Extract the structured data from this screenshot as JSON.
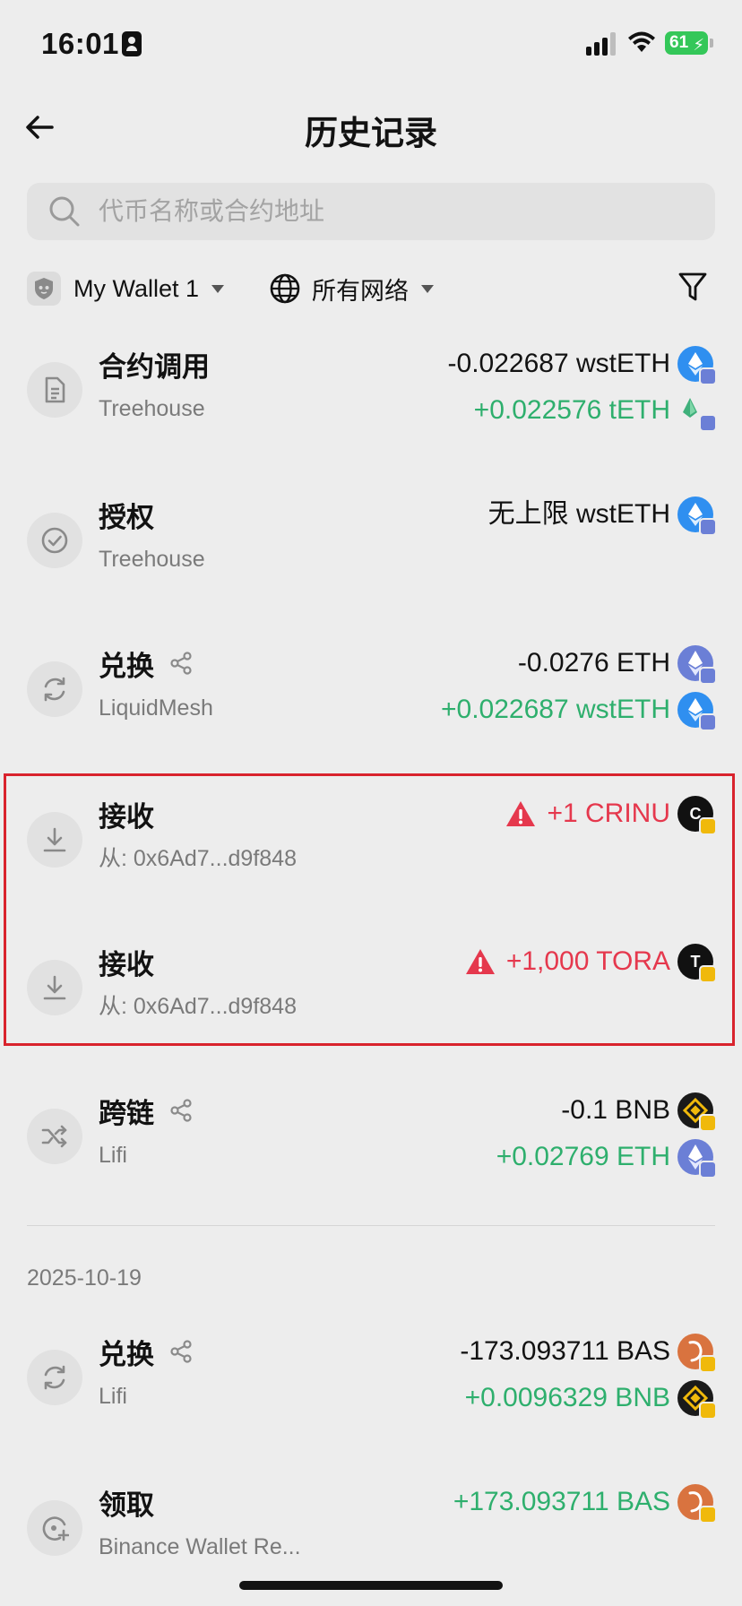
{
  "status_bar": {
    "time": "16:01",
    "battery": "61"
  },
  "header": {
    "title": "历史记录"
  },
  "search": {
    "placeholder": "代币名称或合约地址"
  },
  "filters": {
    "wallet": "My Wallet 1",
    "network": "所有网络"
  },
  "colors": {
    "positive": "#2eaf6d",
    "warning": "#e5384d",
    "highlight_border": "#d9232d"
  },
  "transactions": [
    {
      "type": "合约调用",
      "sub": "Treehouse",
      "icon": "document-icon",
      "amounts": [
        {
          "text": "-0.022687 wstETH",
          "tone": "neg",
          "token": "wstETH"
        },
        {
          "text": "+0.022576 tETH",
          "tone": "pos",
          "token": "tETH"
        }
      ]
    },
    {
      "type": "授权",
      "sub": "Treehouse",
      "icon": "check-circle-icon",
      "amounts": [
        {
          "text": "无上限 wstETH",
          "tone": "neg",
          "token": "wstETH"
        }
      ]
    },
    {
      "type": "兑换",
      "sub": "LiquidMesh",
      "icon": "swap-icon",
      "shareable": true,
      "amounts": [
        {
          "text": "-0.0276 ETH",
          "tone": "neg",
          "token": "ETH"
        },
        {
          "text": "+0.022687 wstETH",
          "tone": "pos",
          "token": "wstETH"
        }
      ]
    },
    {
      "type": "接收",
      "sub": "从: 0x6Ad7...d9f848",
      "icon": "download-icon",
      "flagged": true,
      "amounts": [
        {
          "text": "+1 CRINU",
          "tone": "warn",
          "token": "CRINU"
        }
      ]
    },
    {
      "type": "接收",
      "sub": "从: 0x6Ad7...d9f848",
      "icon": "download-icon",
      "flagged": true,
      "amounts": [
        {
          "text": "+1,000 TORA",
          "tone": "warn",
          "token": "TORA"
        }
      ]
    },
    {
      "type": "跨链",
      "sub": "Lifi",
      "icon": "shuffle-icon",
      "shareable": true,
      "amounts": [
        {
          "text": "-0.1 BNB",
          "tone": "neg",
          "token": "BNB"
        },
        {
          "text": "+0.02769 ETH",
          "tone": "pos",
          "token": "ETH"
        }
      ]
    }
  ],
  "date_group": "2025-10-19",
  "transactions_2": [
    {
      "type": "兑换",
      "sub": "Lifi",
      "icon": "swap-icon",
      "shareable": true,
      "amounts": [
        {
          "text": "-173.093711 BAS",
          "tone": "neg",
          "token": "BAS"
        },
        {
          "text": "+0.0096329 BNB",
          "tone": "pos",
          "token": "BNB"
        }
      ]
    },
    {
      "type": "领取",
      "sub": "Binance Wallet Re...",
      "icon": "claim-icon",
      "amounts": [
        {
          "text": "+173.093711 BAS",
          "tone": "pos",
          "token": "BAS"
        }
      ]
    }
  ]
}
